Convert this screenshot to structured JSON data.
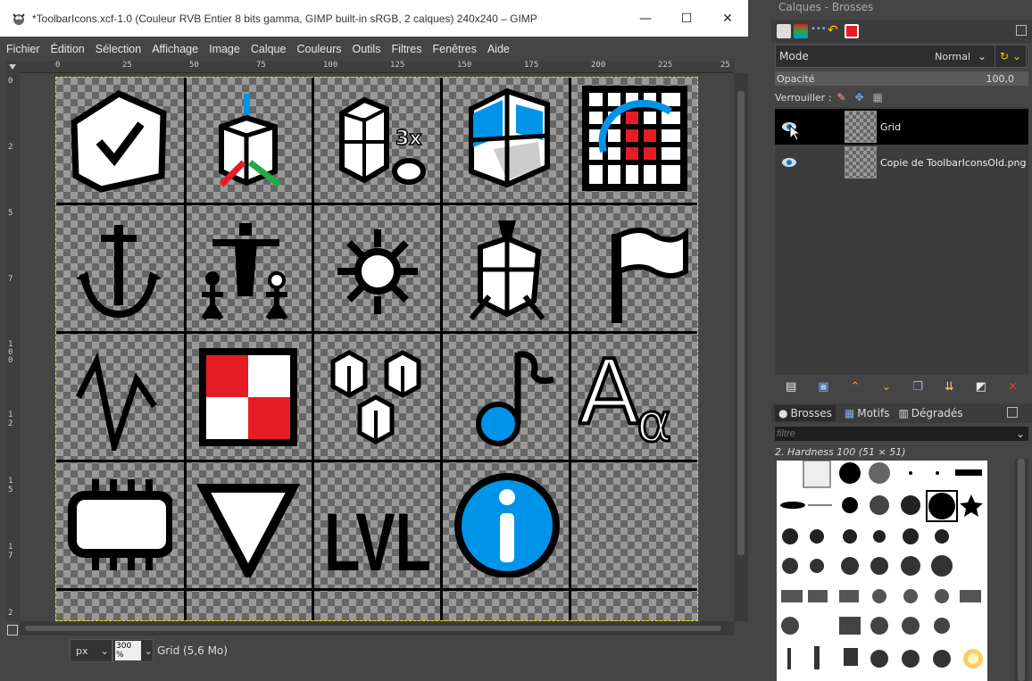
{
  "window": {
    "title": "*ToolbarIcons.xcf-1.0 (Couleur RVB Entier 8 bits gamma, GIMP built-in sRGB, 2 calques) 240x240 – GIMP",
    "minimize": "—",
    "maximize": "☐",
    "close": "✕"
  },
  "menu": [
    "Fichier",
    "Édition",
    "Sélection",
    "Affichage",
    "Image",
    "Calque",
    "Couleurs",
    "Outils",
    "Filtres",
    "Fenêtres",
    "Aide"
  ],
  "ruler": {
    "top_labels": [
      "0",
      "25",
      "50",
      "75",
      "100",
      "125",
      "150",
      "175",
      "200",
      "225",
      "25"
    ],
    "left_labels": [
      "0",
      "2",
      "5",
      "7",
      "1 0 0",
      "1 2",
      "1 5",
      "1 7",
      "2"
    ]
  },
  "status": {
    "unit": "px",
    "zoom": "300 %",
    "info": "Grid (5,6 Mo)"
  },
  "panel": {
    "title": "Calques - Brosses",
    "mode_label": "Mode",
    "mode_value": "Normal",
    "opacity_label": "Opacité",
    "opacity_value": "100,0",
    "lock_label": "Verrouiller :",
    "layers": [
      {
        "name": "Grid",
        "selected": true
      },
      {
        "name": "Copie de ToolbarIconsOld.png",
        "selected": false
      }
    ]
  },
  "brushes": {
    "tabs": [
      "Brosses",
      "Motifs",
      "Dégradés"
    ],
    "filter_placeholder": "filtre",
    "current": "2. Hardness 100 (51 × 51)"
  },
  "colors": {
    "accent_blue": "#0094e8",
    "red": "#e61c24",
    "green": "#22aa44",
    "selection_yellow": "#e6e600"
  }
}
